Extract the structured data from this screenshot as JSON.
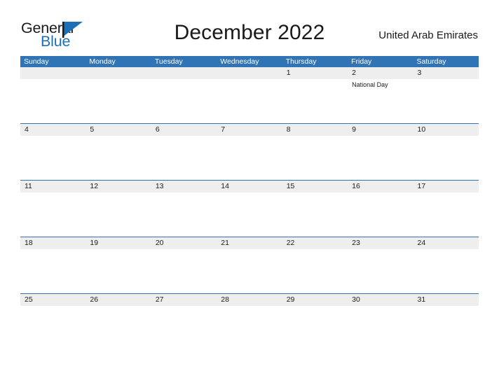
{
  "logo": {
    "text_top": "General",
    "text_bottom": "Blue",
    "flag_icon": "blue-flag-triangle-icon",
    "top_color": "#1a1a1a",
    "bottom_color": "#1f6fb5"
  },
  "header": {
    "title": "December 2022",
    "country": "United Arab Emirates"
  },
  "colors": {
    "header_blue": "#3174b5",
    "row_band_gray": "#eeeeee",
    "rule_blue": "#3174b5",
    "text": "#1a1a1a",
    "header_text": "#ffffff"
  },
  "calendar": {
    "month": "December",
    "year": "2022",
    "day_headers": [
      "Sunday",
      "Monday",
      "Tuesday",
      "Wednesday",
      "Thursday",
      "Friday",
      "Saturday"
    ],
    "weeks": [
      {
        "days": [
          {
            "num": "",
            "event": ""
          },
          {
            "num": "",
            "event": ""
          },
          {
            "num": "",
            "event": ""
          },
          {
            "num": "",
            "event": ""
          },
          {
            "num": "1",
            "event": ""
          },
          {
            "num": "2",
            "event": "National Day"
          },
          {
            "num": "3",
            "event": ""
          }
        ]
      },
      {
        "days": [
          {
            "num": "4",
            "event": ""
          },
          {
            "num": "5",
            "event": ""
          },
          {
            "num": "6",
            "event": ""
          },
          {
            "num": "7",
            "event": ""
          },
          {
            "num": "8",
            "event": ""
          },
          {
            "num": "9",
            "event": ""
          },
          {
            "num": "10",
            "event": ""
          }
        ]
      },
      {
        "days": [
          {
            "num": "11",
            "event": ""
          },
          {
            "num": "12",
            "event": ""
          },
          {
            "num": "13",
            "event": ""
          },
          {
            "num": "14",
            "event": ""
          },
          {
            "num": "15",
            "event": ""
          },
          {
            "num": "16",
            "event": ""
          },
          {
            "num": "17",
            "event": ""
          }
        ]
      },
      {
        "days": [
          {
            "num": "18",
            "event": ""
          },
          {
            "num": "19",
            "event": ""
          },
          {
            "num": "20",
            "event": ""
          },
          {
            "num": "21",
            "event": ""
          },
          {
            "num": "22",
            "event": ""
          },
          {
            "num": "23",
            "event": ""
          },
          {
            "num": "24",
            "event": ""
          }
        ]
      },
      {
        "days": [
          {
            "num": "25",
            "event": ""
          },
          {
            "num": "26",
            "event": ""
          },
          {
            "num": "27",
            "event": ""
          },
          {
            "num": "28",
            "event": ""
          },
          {
            "num": "29",
            "event": ""
          },
          {
            "num": "30",
            "event": ""
          },
          {
            "num": "31",
            "event": ""
          }
        ]
      }
    ]
  }
}
